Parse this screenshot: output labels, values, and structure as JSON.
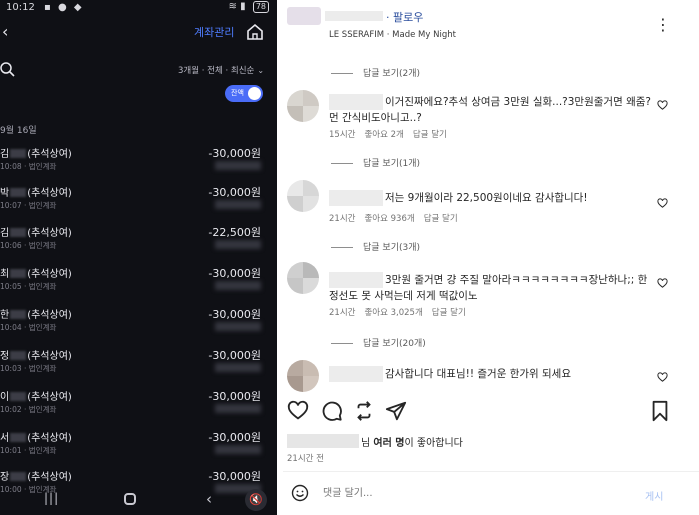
{
  "left_app": {
    "status": {
      "time": "10:12",
      "battery": "78"
    },
    "header": {
      "account_manage": "계좌관리"
    },
    "filter": {
      "label": "3개월 · 전체 · 최신순"
    },
    "toggle": {
      "label": "잔액"
    },
    "date_header": "9월 16일",
    "transactions": [
      {
        "name_prefix": "김",
        "name_suffix": "(추석상여)",
        "amount": "-30,000원",
        "time": "10:08",
        "type": "법인계좌"
      },
      {
        "name_prefix": "박",
        "name_suffix": "(추석상여)",
        "amount": "-30,000원",
        "time": "10:07",
        "type": "법인계좌"
      },
      {
        "name_prefix": "김",
        "name_suffix": "(추석상여)",
        "amount": "-22,500원",
        "time": "10:06",
        "type": "법인계좌"
      },
      {
        "name_prefix": "최",
        "name_suffix": "(추석상여)",
        "amount": "-30,000원",
        "time": "10:05",
        "type": "법인계좌"
      },
      {
        "name_prefix": "한",
        "name_suffix": "(추석상여)",
        "amount": "-30,000원",
        "time": "10:04",
        "type": "법인계좌"
      },
      {
        "name_prefix": "정",
        "name_suffix": "(추석상여)",
        "amount": "-30,000원",
        "time": "10:03",
        "type": "법인계좌"
      },
      {
        "name_prefix": "이",
        "name_suffix": "(추석상여)",
        "amount": "-30,000원",
        "time": "10:02",
        "type": "법인계좌"
      },
      {
        "name_prefix": "서",
        "name_suffix": "(추석상여)",
        "amount": "-30,000원",
        "time": "10:01",
        "type": "법인계좌"
      },
      {
        "name_prefix": "장",
        "name_suffix": "(추석상여)",
        "amount": "-30,000원",
        "time": "10:00",
        "type": "법인계좌"
      }
    ]
  },
  "right_app": {
    "header": {
      "follow": "· 팔로우",
      "music": "LE SSERAFIM · Made My Night"
    },
    "replies_top": "답글 보기(2개)",
    "comments": [
      {
        "text": "이거진짜에요?추석 상여금 3만원 실화...?3만원줄거면 왜줌? 먼 간식비도아니고..?",
        "time": "15시간",
        "likes": "좋아요 2개",
        "reply": "답글 달기",
        "view_replies": "답글 보기(1개)",
        "avatar_colors": [
          "#d9d6d0",
          "#cfcac4",
          "#c4bfb8",
          "#dedbd6"
        ]
      },
      {
        "text": "저는 9개월이라 22,500원이네요 감사합니다!",
        "time": "21시간",
        "likes": "좋아요 936개",
        "reply": "답글 달기",
        "view_replies": "답글 보기(3개)",
        "avatar_colors": [
          "#e8e8e8",
          "#d7d7d7",
          "#cfcfcf",
          "#e2e2e2"
        ]
      },
      {
        "text": "3만원 줄거면 걍 주질 말아라ㅋㅋㅋㅋㅋㅋㅋㅋ장난하나;; 한정선도 못 사먹는데 저게 떡값이노",
        "time": "21시간",
        "likes": "좋아요 3,025개",
        "reply": "답글 달기",
        "view_replies": "답글 보기(20개)",
        "avatar_colors": [
          "#cfcfcf",
          "#b9b9b9",
          "#c6c6c6",
          "#dadada"
        ]
      },
      {
        "text": "감사합니다 대표님!! 즐거운 한가위 되세요",
        "avatar_colors": [
          "#b8aaa0",
          "#c9bcb2",
          "#a8998f",
          "#d2c6bd"
        ]
      }
    ],
    "likes_text": {
      "suffix": "님 ",
      "bold": "여러 명",
      "end": "이 좋아합니다"
    },
    "post_time": "21시간 전",
    "input_placeholder": "댓글 달기...",
    "post_button": "게시"
  }
}
